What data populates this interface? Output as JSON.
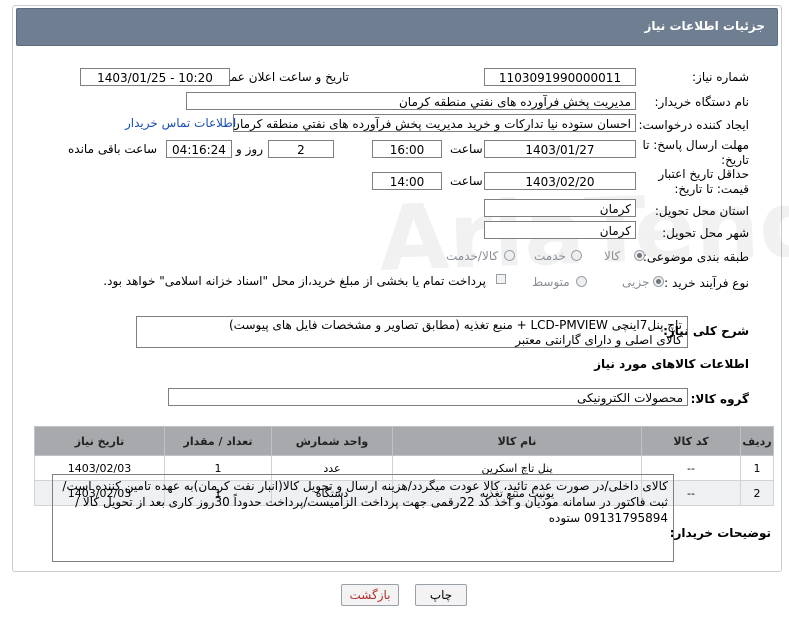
{
  "header": {
    "title": "جزئیات اطلاعات نیاز"
  },
  "labels": {
    "need_number": "شماره نیاز:",
    "announce_datetime": "تاریخ و ساعت اعلان عمومی:",
    "buyer_org": "نام دستگاه خریدار:",
    "requester": "ایجاد کننده درخواست:",
    "contact_link": "اطلاعات تماس خریدار",
    "reply_deadline": "مهلت ارسال پاسخ: تا تاریخ:",
    "hour": "ساعت",
    "day_and": "روز و",
    "remaining": "ساعت باقی مانده",
    "price_validity": "حداقل تاریخ اعتبار قیمت: تا تاریخ:",
    "province": "استان محل تحویل:",
    "city": "شهر محل تحویل:",
    "category": "طبقه بندی موضوعی:",
    "process_type": "نوع فرآیند خرید :",
    "general_desc": "شرح کلی نیاز:",
    "goods_info": "اطلاعات کالاهای مورد نیاز",
    "goods_group": "گروه کالا:",
    "buyer_notes": "توضیحات خریدار:"
  },
  "fields": {
    "need_number": "1103091990000011",
    "announce_datetime": "1403/01/25 - 10:20",
    "buyer_org": "مدیریت پخش فرآورده های نفتي منطقه کرمان",
    "requester": "احسان  ستوده نیا  تدارکات و خرید  مدیریت پخش فرآورده های نفتي منطقه کرمان",
    "reply_date": "1403/01/27",
    "reply_time": "16:00",
    "days": "2",
    "remaining_time": "04:16:24",
    "validity_date": "1403/02/20",
    "validity_time": "14:00",
    "province": "کرمان",
    "city": "کرمان",
    "general_desc_line1": "تاچ پنل7اینچی LCD-PMVIEW + منبع تغذیه (مطابق تصاویر و مشخصات فایل های پیوست)",
    "general_desc_line2": "کالای  اصلی و دارای گارانتی معتبر",
    "goods_group": "محصولات الکترونیکی",
    "buyer_notes": "کالای داخلی/در صورت عدم تائید، کالا عودت میگردد/هزینه ارسال و تحویل کالا(انبار نفت کرمان)به عهده تامین کننده است/ ثبت فاکتور در سامانه مودیان و اخذ کد 22رقمی جهت پرداخت الزامیست/پرداخت حدوداً 30روز کاری بعد از تحویل کالا / 09131795894 ستوده"
  },
  "category_options": [
    {
      "label": "کالا",
      "selected": true
    },
    {
      "label": "خدمت",
      "selected": false
    },
    {
      "label": "کالا/خدمت",
      "selected": false
    }
  ],
  "process_options": [
    {
      "label": "جزیی",
      "selected": true
    },
    {
      "label": "متوسط",
      "selected": false
    }
  ],
  "payment_note": "پرداخت تمام یا بخشی از مبلغ خرید،از محل \"اسناد خزانه اسلامی\" خواهد بود.",
  "table": {
    "headers": [
      "ردیف",
      "کد کالا",
      "نام کالا",
      "واحد شمارش",
      "تعداد / مقدار",
      "تاریخ نیاز"
    ],
    "rows": [
      [
        "1",
        "--",
        "پنل تاچ اسکرین",
        "عدد",
        "1",
        "1403/02/03"
      ],
      [
        "2",
        "--",
        "یونیت منبع تغذیه",
        "دستگاه",
        "1",
        "1403/02/03"
      ]
    ]
  },
  "buttons": {
    "print": "چاپ",
    "back": "بازگشت"
  }
}
